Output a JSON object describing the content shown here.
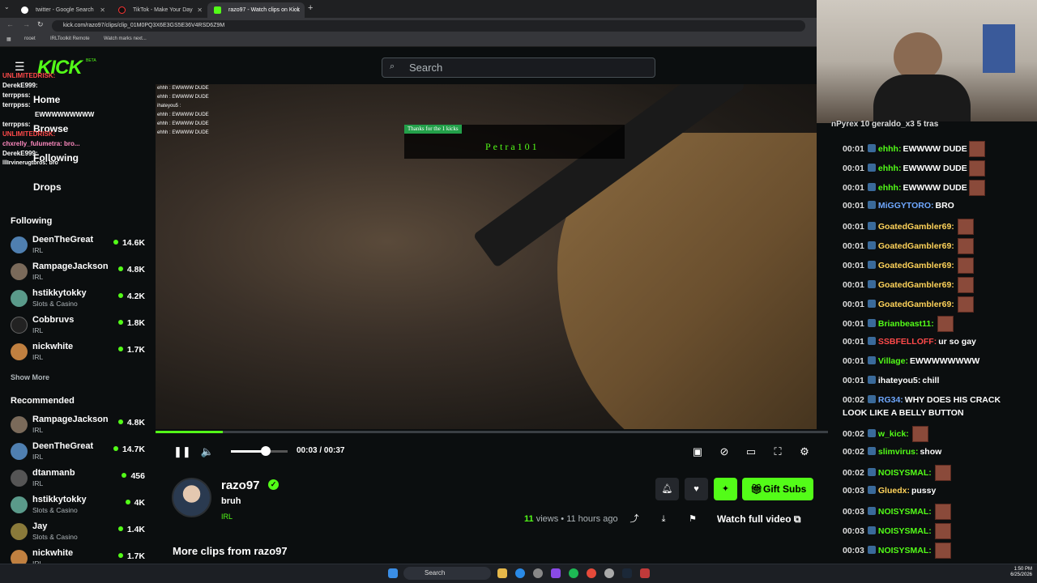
{
  "browser": {
    "tabs": [
      {
        "label": "twitter - Google Search",
        "active": false
      },
      {
        "label": "TikTok - Make Your Day",
        "active": false
      },
      {
        "label": "razo97 - Watch clips on Kick",
        "active": true
      }
    ],
    "url": "kick.com/razo97/clips/clip_01M0PQ3X6E3GS5E36V4RSD6Z9M",
    "bookmarks": [
      "rooet",
      "IRLToolkit Remote",
      "Watch marks next..."
    ]
  },
  "header": {
    "logo": "KICK",
    "logo_badge": "BETA",
    "search_placeholder": "Search"
  },
  "nav": {
    "home": "Home",
    "browse": "Browse",
    "following": "Following",
    "drops": "Drops"
  },
  "overlay_chat": [
    "UNLIMITEDRISK:",
    "DerekE999:",
    "terrppss:",
    "terrppss:",
    "EWWWWWWWWW",
    "terrppss:",
    "UNLIMITEDRISK:",
    "chxrelly_fulumetra: bro...",
    "DerekE999:",
    "lllIrvinerugtbros: bro"
  ],
  "sidebar": {
    "following_heading": "Following",
    "following": [
      {
        "name": "DeenTheGreat",
        "category": "IRL",
        "viewers": "14.6K"
      },
      {
        "name": "RampageJackson",
        "category": "IRL",
        "viewers": "4.8K"
      },
      {
        "name": "hstikkytokky",
        "category": "Slots & Casino",
        "viewers": "4.2K"
      },
      {
        "name": "Cobbruvs",
        "category": "IRL",
        "viewers": "1.8K"
      },
      {
        "name": "nickwhite",
        "category": "IRL",
        "viewers": "1.7K"
      }
    ],
    "show_more": "Show More",
    "recommended_heading": "Recommended",
    "recommended": [
      {
        "name": "RampageJackson",
        "category": "IRL",
        "viewers": "4.8K"
      },
      {
        "name": "DeenTheGreat",
        "category": "IRL",
        "viewers": "14.7K"
      },
      {
        "name": "dtanmanb",
        "category": "IRL",
        "viewers": "456"
      },
      {
        "name": "hstikkytokky",
        "category": "Slots & Casino",
        "viewers": "4K"
      },
      {
        "name": "Jay",
        "category": "Slots & Casino",
        "viewers": "1.4K"
      },
      {
        "name": "nickwhite",
        "category": "IRL",
        "viewers": "1.7K"
      }
    ]
  },
  "video": {
    "alert_top": "Thanks for the 1 kicks",
    "alert_name": "Petra101",
    "in_video_chat": [
      "ehhh : EWWWW DUDE",
      "ehhh : EWWWW DUDE",
      "ihateyou5 :",
      "ehhh : EWWWW DUDE",
      "ehhh : EWWWW DUDE",
      "ehhh : EWWWW DUDE"
    ],
    "progress_fraction": 0.1,
    "volume_fraction": 0.62,
    "current_time": "00:03",
    "duration": "00:37",
    "time_separator": "/"
  },
  "clip": {
    "channel": "razo97",
    "title": "bruh",
    "category": "IRL",
    "views_count": "11",
    "views_label": "views",
    "age": "11 hours ago",
    "gift_subs": "Gift Subs",
    "watch_full": "Watch full video",
    "more_clips": "More clips from razo97"
  },
  "chat": {
    "pinned": "nPyrex 10   geraldo_x3 5   tras",
    "messages": [
      {
        "time": "00:01",
        "user": "ehhh:",
        "color": "#53fc18",
        "text": "EWWWW DUDE",
        "emote": true
      },
      {
        "time": "00:01",
        "user": "ehhh:",
        "color": "#53fc18",
        "text": "EWWWW DUDE",
        "emote": true
      },
      {
        "time": "00:01",
        "user": "ehhh:",
        "color": "#53fc18",
        "text": "EWWWW DUDE",
        "emote": true
      },
      {
        "time": "00:01",
        "user": "MiGGYTORO:",
        "color": "#6fa8ff",
        "text": "BRO",
        "emote": false
      },
      {
        "time": "00:01",
        "user": "GoatedGambler69:",
        "color": "#ffd35a",
        "text": "",
        "emote": true
      },
      {
        "time": "00:01",
        "user": "GoatedGambler69:",
        "color": "#ffd35a",
        "text": "",
        "emote": true
      },
      {
        "time": "00:01",
        "user": "GoatedGambler69:",
        "color": "#ffd35a",
        "text": "",
        "emote": true
      },
      {
        "time": "00:01",
        "user": "GoatedGambler69:",
        "color": "#ffd35a",
        "text": "",
        "emote": true
      },
      {
        "time": "00:01",
        "user": "GoatedGambler69:",
        "color": "#ffd35a",
        "text": "",
        "emote": true
      },
      {
        "time": "00:01",
        "user": "Brianbeast11:",
        "color": "#53fc18",
        "text": "",
        "emote": true
      },
      {
        "time": "00:01",
        "user": "SSBFELLOFF:",
        "color": "#ff4a4a",
        "text": "ur so gay",
        "emote": false
      },
      {
        "time": "00:01",
        "user": "Village:",
        "color": "#53fc18",
        "text": "EWWWWWWWW",
        "emote": false
      },
      {
        "time": "00:01",
        "user": "ihateyou5:",
        "color": "#ffffff",
        "text": "chill",
        "emote": false
      },
      {
        "time": "00:02",
        "user": "RG34:",
        "color": "#6fa8ff",
        "text": "WHY DOES HIS CRACK LOOK LIKE A BELLY BUTTON",
        "emote": false
      },
      {
        "time": "00:02",
        "user": "w_kick:",
        "color": "#53fc18",
        "text": "",
        "emote": true
      },
      {
        "time": "00:02",
        "user": "slimvirus:",
        "color": "#53fc18",
        "text": "show",
        "emote": false
      },
      {
        "time": "00:02",
        "user": "NOISYSMAL:",
        "color": "#53fc18",
        "text": "",
        "emote": true
      },
      {
        "time": "00:03",
        "user": "Gluedx:",
        "color": "#ffd35a",
        "text": "pussy",
        "emote": false
      },
      {
        "time": "00:03",
        "user": "NOISYSMAL:",
        "color": "#53fc18",
        "text": "",
        "emote": true
      },
      {
        "time": "00:03",
        "user": "NOISYSMAL:",
        "color": "#53fc18",
        "text": "",
        "emote": true
      },
      {
        "time": "00:03",
        "user": "NOISYSMAL:",
        "color": "#53fc18",
        "text": "",
        "emote": true
      }
    ]
  },
  "taskbar": {
    "search": "Search",
    "time": "1:50 PM",
    "date": "6/25/2026"
  },
  "colors": {
    "accent": "#53fc18",
    "bg": "#0b0e0f"
  }
}
